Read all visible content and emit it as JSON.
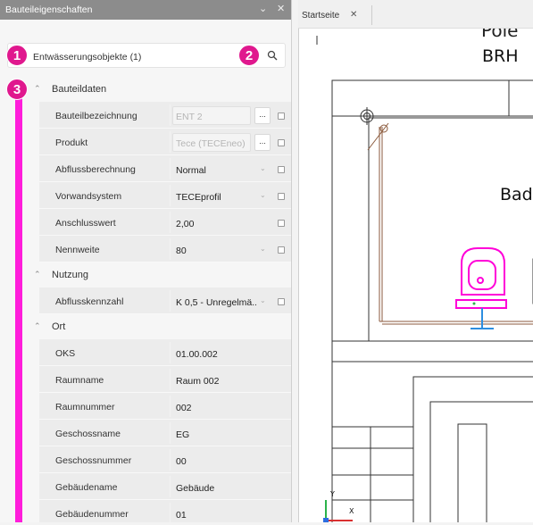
{
  "panel": {
    "title": "Bauteileigenschaften",
    "filter_text": "Entwässerungsobjekte (1)",
    "badges": [
      "1",
      "2",
      "3"
    ]
  },
  "groups": [
    {
      "label": "Bauteildaten",
      "rows": [
        {
          "label": "Bauteilbezeichnung",
          "value": "ENT 2",
          "kind": "text-disabled-button"
        },
        {
          "label": "Produkt",
          "value": "Tece (TECEneo) W",
          "kind": "text-disabled-button"
        },
        {
          "label": "Abflussberechnung",
          "value": "Normal",
          "kind": "dropdown"
        },
        {
          "label": "Vorwandsystem",
          "value": "TECEprofil",
          "kind": "dropdown"
        },
        {
          "label": "Anschlusswert",
          "value": "2,00",
          "kind": "plain"
        },
        {
          "label": "Nennweite",
          "value": "80",
          "kind": "dropdown"
        }
      ]
    },
    {
      "label": "Nutzung",
      "rows": [
        {
          "label": "Abflusskennzahl",
          "value": "K 0,5 - Unregelmä...",
          "kind": "dropdown"
        }
      ]
    },
    {
      "label": "Ort",
      "rows": [
        {
          "label": "OKS",
          "value": "01.00.002",
          "kind": "readonly"
        },
        {
          "label": "Raumname",
          "value": "Raum 002",
          "kind": "readonly"
        },
        {
          "label": "Raumnummer",
          "value": "002",
          "kind": "readonly"
        },
        {
          "label": "Geschossname",
          "value": "EG",
          "kind": "readonly"
        },
        {
          "label": "Geschossnummer",
          "value": "00",
          "kind": "readonly"
        },
        {
          "label": "Gebäudename",
          "value": "Gebäude",
          "kind": "readonly"
        },
        {
          "label": "Gebäudenummer",
          "value": "01",
          "kind": "readonly"
        }
      ]
    }
  ],
  "drawing": {
    "tab_label": "Startseite",
    "text_top": "Pole",
    "text_brh": "BRH",
    "text_bad": "Bad",
    "axis_y": "Y",
    "axis_x": "X"
  },
  "colors": {
    "accent": "#e0188e",
    "highlight_bar": "#ff1ddb",
    "fixture": "#ff00d8",
    "pipe": "#2d8ee0",
    "wall": "#8b5a3c"
  }
}
